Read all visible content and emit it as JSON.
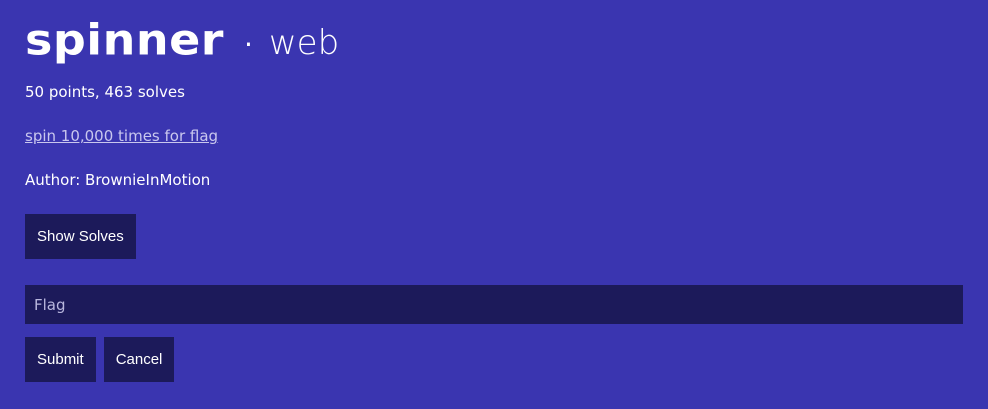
{
  "challenge": {
    "name": "spinner",
    "separator": "·",
    "category": "web",
    "stats": "50 points, 463 solves",
    "description_link": "spin 10,000 times for flag",
    "author": "Author: BrownieInMotion"
  },
  "buttons": {
    "show_solves": "Show Solves",
    "submit": "Submit",
    "cancel": "Cancel"
  },
  "flag_input": {
    "placeholder": "Flag",
    "value": ""
  },
  "colors": {
    "background": "#3a35b0",
    "panel": "#1c1a5a",
    "link": "#c9c7ee"
  }
}
